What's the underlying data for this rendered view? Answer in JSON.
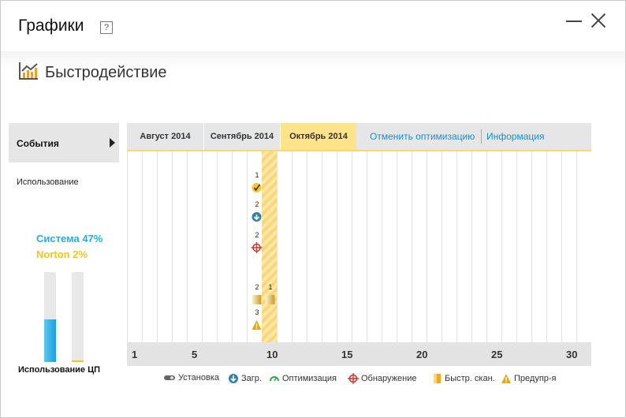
{
  "window": {
    "title": "Графики",
    "help_label": "?"
  },
  "section": {
    "title": "Быстродействие"
  },
  "sidebar": {
    "events_label": "События",
    "usage_label": "Использование"
  },
  "cpu": {
    "system_label": "Система 47%",
    "norton_label": "Norton 2%",
    "system_percent": 47,
    "norton_percent": 2,
    "caption": "Использование ЦП",
    "system_color": "#22b0e0",
    "norton_color": "#f2c51a"
  },
  "chart": {
    "months": [
      "Август 2014",
      "Сентябрь 2014",
      "Октябрь 2014"
    ],
    "active_month": "Октябрь 2014",
    "links": [
      "Отменить оптимизацию",
      "Информация"
    ],
    "x_ticks": [
      "1",
      "5",
      "10",
      "15",
      "20",
      "25",
      "30"
    ],
    "highlight_day": 10,
    "events": [
      {
        "day": 9,
        "type": "optimization",
        "count": "1"
      },
      {
        "day": 9,
        "type": "download",
        "count": "2"
      },
      {
        "day": 9,
        "type": "detection",
        "count": "2"
      },
      {
        "day": 9,
        "type": "quick-scan",
        "count": "2"
      },
      {
        "day": 10,
        "type": "quick-scan",
        "count": "1"
      },
      {
        "day": 9,
        "type": "warning",
        "count": "3"
      }
    ]
  },
  "legend": [
    {
      "icon": "install-icon",
      "label": "Установка"
    },
    {
      "icon": "download-icon",
      "label": "Загр."
    },
    {
      "icon": "optimization-icon",
      "label": "Оптимизация"
    },
    {
      "icon": "detection-icon",
      "label": "Обнаружение"
    },
    {
      "icon": "quick-scan-icon",
      "label": "Быстр. скан."
    },
    {
      "icon": "warning-icon",
      "label": "Предупр-я"
    }
  ]
}
